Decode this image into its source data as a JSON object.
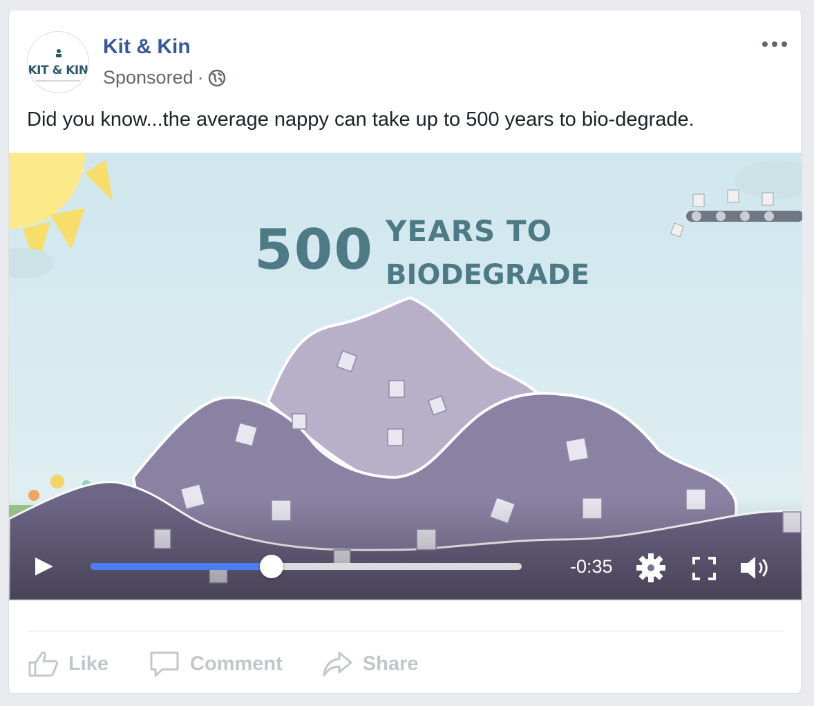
{
  "post": {
    "page_name": "Kit & Kin",
    "logo_text": "KIT & KIN",
    "sponsored": "Sponsored",
    "separator": "·",
    "text": "Did you know...the average nappy can take up to 500 years to bio-degrade.",
    "icons": {
      "privacy": "globe-icon",
      "options": "more-options-icon"
    }
  },
  "video": {
    "headline_number": "500",
    "headline_line1": "YEARS TO",
    "headline_line2": "BIODEGRADE",
    "time_remaining": "-0:35",
    "progress_fraction": 0.42,
    "colors": {
      "sky": "#d3e9ef",
      "headline": "#4d7a85",
      "mountain_back": "#b7b0c8",
      "mountain_front": "#8a82a3",
      "progress_fill": "#4a7ef0"
    },
    "icons": {
      "play": "play-icon",
      "settings": "gear-icon",
      "fullscreen": "fullscreen-icon",
      "volume": "volume-icon"
    }
  },
  "actions": [
    {
      "label": "Like",
      "icon": "thumbs-up-icon"
    },
    {
      "label": "Comment",
      "icon": "comment-icon"
    },
    {
      "label": "Share",
      "icon": "share-icon"
    }
  ]
}
